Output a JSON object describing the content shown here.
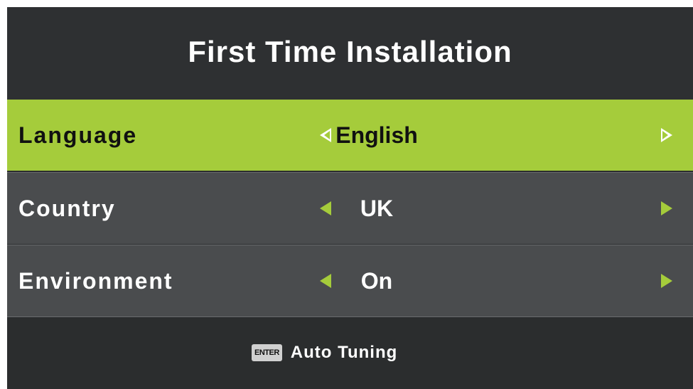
{
  "title": "First Time Installation",
  "settings": [
    {
      "label": "Language",
      "value": "English",
      "selected": true
    },
    {
      "label": "Country",
      "value": "UK",
      "selected": false
    },
    {
      "label": "Environment",
      "value": "On",
      "selected": false
    }
  ],
  "footer": {
    "key_label": "ENTER",
    "action_label": "Auto Tuning"
  },
  "colors": {
    "accent": "#a5cc3b",
    "background": "#2b2d2e",
    "row": "#4a4c4e"
  }
}
